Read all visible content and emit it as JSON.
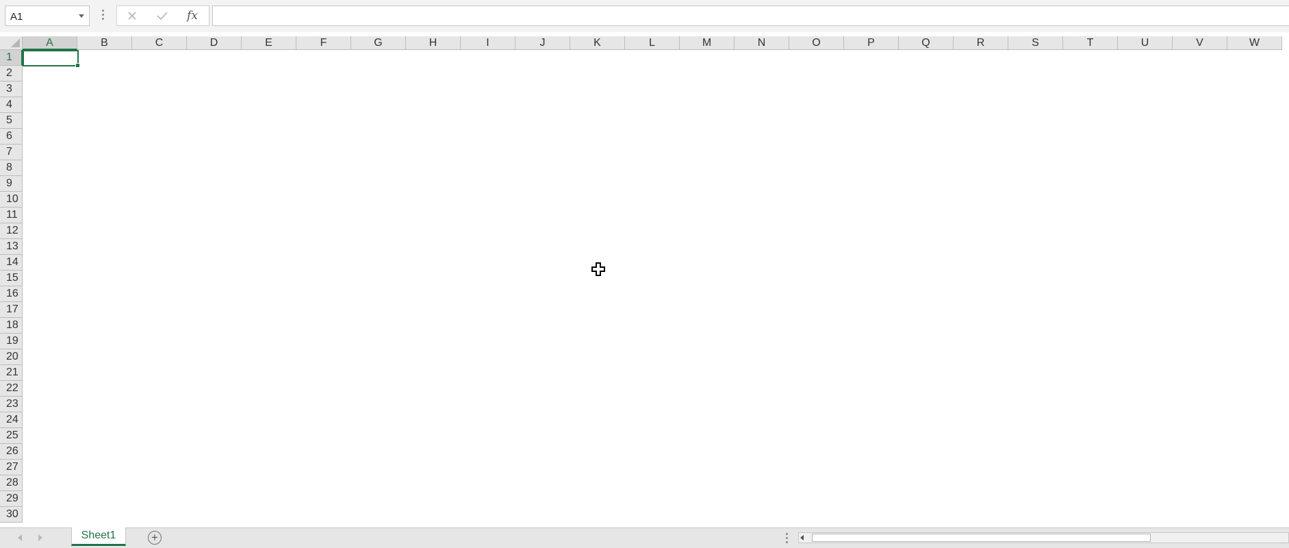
{
  "formula_bar": {
    "name_box_value": "A1",
    "formula_value": "",
    "cancel_icon": "close-icon",
    "enter_icon": "check-icon",
    "fx_label": "fx"
  },
  "grid": {
    "columns": [
      "A",
      "B",
      "C",
      "D",
      "E",
      "F",
      "G",
      "H",
      "I",
      "J",
      "K",
      "L",
      "M",
      "N",
      "O",
      "P",
      "Q",
      "R",
      "S",
      "T",
      "U",
      "V",
      "W"
    ],
    "rows": [
      "1",
      "2",
      "3",
      "4",
      "5",
      "6",
      "7",
      "8",
      "9",
      "10",
      "11",
      "12",
      "13",
      "14",
      "15",
      "16",
      "17",
      "18",
      "19",
      "20",
      "21",
      "22",
      "23",
      "24",
      "25",
      "26",
      "27",
      "28",
      "29",
      "30"
    ],
    "active_cell": "A1",
    "accent_color": "#217346"
  },
  "sheet_bar": {
    "tabs": [
      "Sheet1"
    ],
    "active_tab": "Sheet1",
    "add_sheet_icon": "plus-circle-icon"
  }
}
